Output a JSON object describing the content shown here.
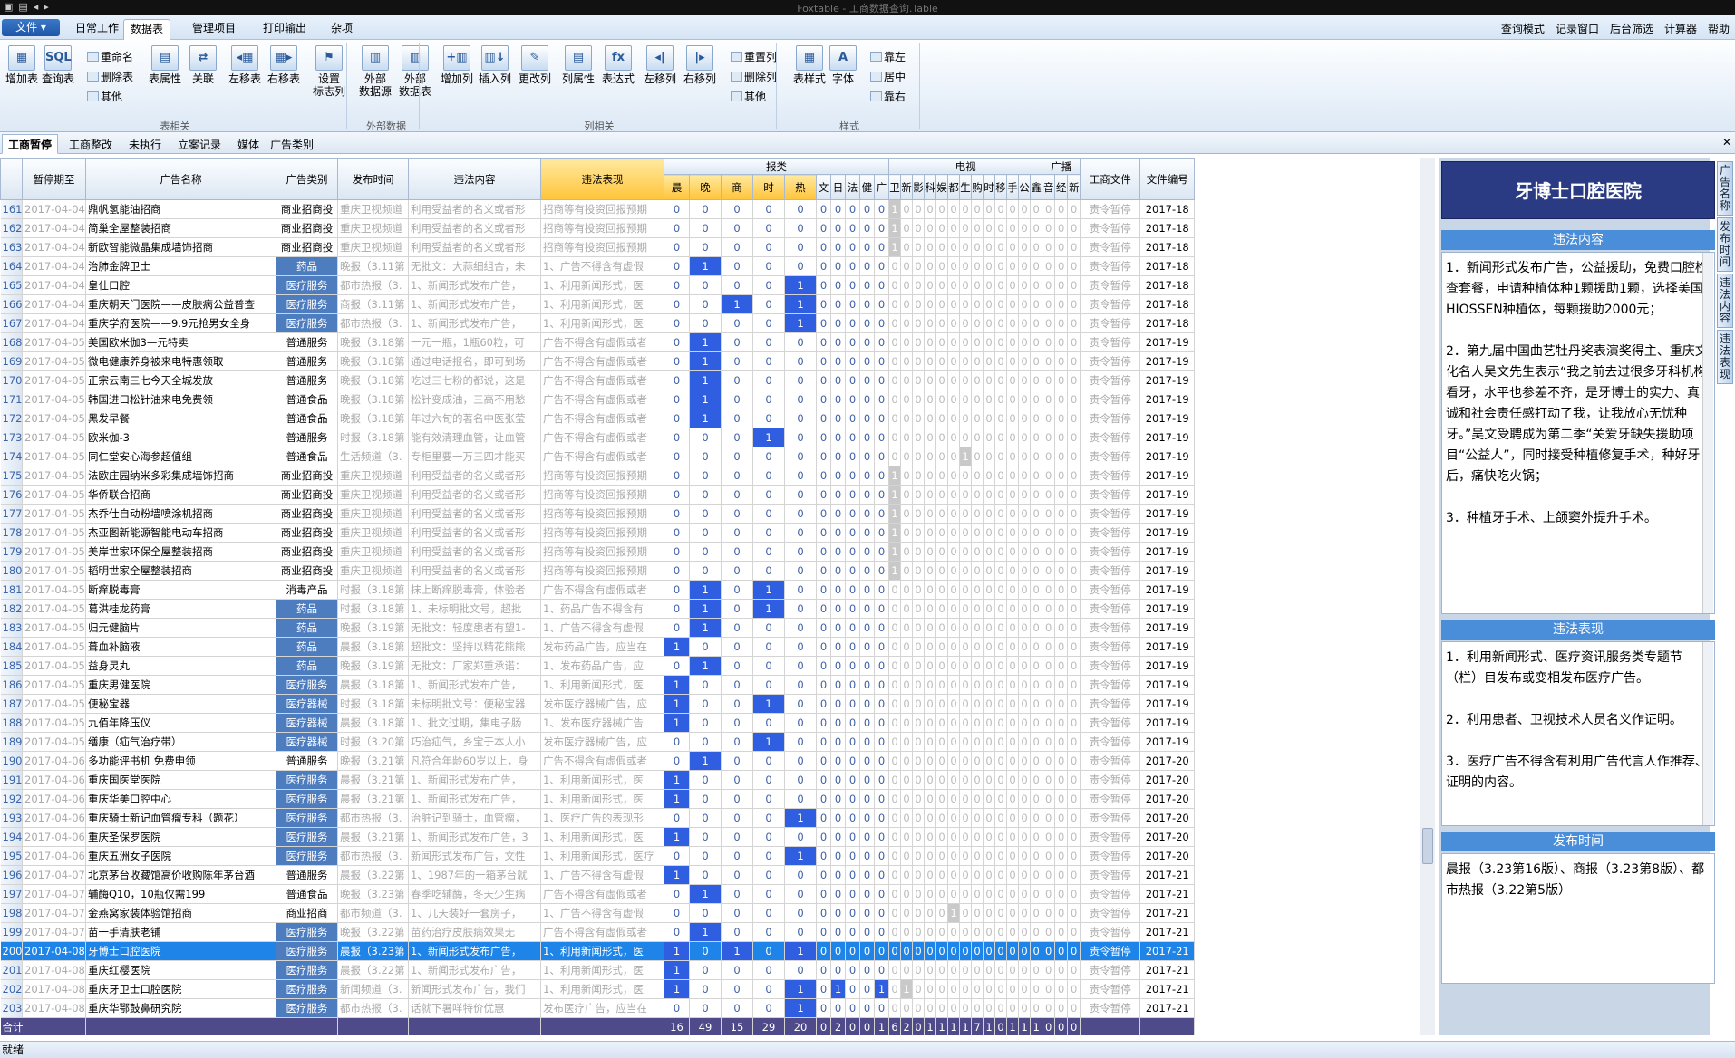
{
  "window_title": "Foxtable - 工商数据查询.Table",
  "menu": {
    "file": "文件 ▾",
    "tabs": [
      "日常工作",
      "数据表",
      "管理项目",
      "打印输出",
      "杂项"
    ],
    "active": 1,
    "right": [
      "查询模式",
      "记录窗口",
      "后台筛选",
      "计算器",
      "帮助"
    ]
  },
  "ribbon": {
    "big": [
      "增加表",
      "查询表",
      "表属性",
      "关联",
      "左移表",
      "右移表",
      "设置\n标志列",
      "外部\n数据源",
      "外部\n数据表",
      "增加列",
      "插入列",
      "更改列",
      "列属性",
      "表达式",
      "左移列",
      "右移列",
      "表样式",
      "字体"
    ],
    "small": [
      "重命名",
      "删除表",
      "其他",
      "重置列",
      "删除列",
      "其他",
      "靠左",
      "居中",
      "靠右"
    ],
    "groups": [
      "表相关",
      "外部数据",
      "列相关",
      "样式"
    ]
  },
  "sheet_tabs": [
    "工商暂停",
    "工商整改",
    "未执行",
    "立案记录",
    "媒体",
    "广告类别"
  ],
  "grid": {
    "headers": {
      "pause": "暂停期至",
      "name": "广告名称",
      "cat": "广告类别",
      "pub": "发布时间",
      "content": "违法内容",
      "behavior": "违法表现",
      "newspaper": "报类",
      "tv": "电视",
      "radio": "广播",
      "doc": "工商文件",
      "docno": "文件编号"
    },
    "newspaper_cols": [
      "晨",
      "晚",
      "商",
      "时",
      "热",
      "文",
      "日",
      "法",
      "健",
      "广"
    ],
    "tv_cols": [
      "卫",
      "新",
      "影",
      "科",
      "娱",
      "都",
      "生",
      "购",
      "时",
      "移",
      "手",
      "公",
      "鑫"
    ],
    "radio_cols": [
      "音",
      "经",
      "新"
    ],
    "rows": [
      [
        "161",
        "2017-04-04",
        "鼎帆氢能油招商",
        "商业招商投",
        "重庆卫视频道",
        "利用受益者的名义或者形",
        "招商等有投资回报预期",
        "0000000000",
        "1000000000000",
        "000",
        "责令暂停",
        "2017-18"
      ],
      [
        "162",
        "2017-04-04",
        "简巢全屋整装招商",
        "商业招商投",
        "重庆卫视频道",
        "利用受益者的名义或者形",
        "招商等有投资回报预期",
        "0000000000",
        "1000000000000",
        "000",
        "责令暂停",
        "2017-18"
      ],
      [
        "163",
        "2017-04-04",
        "新欧智能微晶集成墙饰招商",
        "商业招商投",
        "重庆卫视频道",
        "利用受益者的名义或者形",
        "招商等有投资回报预期",
        "0000000000",
        "1000000000000",
        "000",
        "责令暂停",
        "2017-18"
      ],
      [
        "164",
        "2017-04-04",
        "治肺金牌卫士",
        "药品",
        "晚报（3.11第",
        "无批文：大蒜细组合，未",
        "1、广告不得含有虚假",
        "0100000000",
        "0000000000000",
        "000",
        "责令暂停",
        "2017-18"
      ],
      [
        "165",
        "2017-04-04",
        "皇仕口腔",
        "医疗服务",
        "都市热报（3.",
        "1、新闻形式发布广告，",
        "1、利用新闻形式，医",
        "0000100000",
        "0000000000000",
        "000",
        "责令暂停",
        "2017-18"
      ],
      [
        "166",
        "2017-04-04",
        "重庆朝天门医院——皮肤病公益普查",
        "医疗服务",
        "商报（3.11第",
        "1、新闻形式发布广告，",
        "1、利用新闻形式，医",
        "0010100000",
        "0000000000000",
        "000",
        "责令暂停",
        "2017-18"
      ],
      [
        "167",
        "2017-04-04",
        "重庆学府医院——9.9元抢男女全身",
        "医疗服务",
        "都市热报（3.",
        "1、新闻形式发布广告，",
        "1、利用新闻形式，医",
        "0000100000",
        "0000000000000",
        "000",
        "责令暂停",
        "2017-18"
      ],
      [
        "168",
        "2017-04-05",
        "美国欧米伽3—元特卖",
        "普通服务",
        "晚报（3.18第",
        "一元一瓶，1瓶60粒，可",
        "广告不得含有虚假或者",
        "0100000000",
        "0000000000000",
        "000",
        "责令暂停",
        "2017-19"
      ],
      [
        "169",
        "2017-04-05",
        "微电健康养身被来电特惠领取",
        "普通服务",
        "晚报（3.18第",
        "通过电话报名，即可到场",
        "广告不得含有虚假或者",
        "0100000000",
        "0000000000000",
        "000",
        "责令暂停",
        "2017-19"
      ],
      [
        "170",
        "2017-04-05",
        "正宗云南三七今天全城发放",
        "普通服务",
        "晚报（3.18第",
        "吃过三七粉的都说，这是",
        "广告不得含有虚假或者",
        "0100000000",
        "0000000000000",
        "000",
        "责令暂停",
        "2017-19"
      ],
      [
        "171",
        "2017-04-05",
        "韩国进口松针油来电免费领",
        "普通食品",
        "晚报（3.18第",
        "松针变成油，三高不用愁",
        "广告不得含有虚假或者",
        "0100000000",
        "0000000000000",
        "000",
        "责令暂停",
        "2017-19"
      ],
      [
        "172",
        "2017-04-05",
        "黑发早餐",
        "普通食品",
        "晚报（3.18第",
        "年过六旬的著名中医张莹",
        "广告不得含有虚假或者",
        "0100000000",
        "0000000000000",
        "000",
        "责令暂停",
        "2017-19"
      ],
      [
        "173",
        "2017-04-05",
        "欧米伽-3",
        "普通服务",
        "时报（3.18第",
        "能有效清理血管，让血管",
        "广告不得含有虚假或者",
        "0001000000",
        "0000000000000",
        "000",
        "责令暂停",
        "2017-19"
      ],
      [
        "174",
        "2017-04-05",
        "同仁堂安心海参超值组",
        "普通食品",
        "生活频道（3.",
        "专柜里要一万三四才能买",
        "广告不得含有虚假或者",
        "0000000000",
        "0000001000000",
        "000",
        "责令暂停",
        "2017-19"
      ],
      [
        "175",
        "2017-04-05",
        "法欧庄园纳米多彩集成墙饰招商",
        "商业招商投",
        "重庆卫视频道",
        "利用受益者的名义或者形",
        "招商等有投资回报预期",
        "0000000000",
        "1000000000000",
        "000",
        "责令暂停",
        "2017-19"
      ],
      [
        "176",
        "2017-04-05",
        "华侨联合招商",
        "商业招商投",
        "重庆卫视频道",
        "利用受益者的名义或者形",
        "招商等有投资回报预期",
        "0000000000",
        "1000000000000",
        "000",
        "责令暂停",
        "2017-19"
      ],
      [
        "177",
        "2017-04-05",
        "杰乔仕自动粉墙喷涂机招商",
        "商业招商投",
        "重庆卫视频道",
        "利用受益者的名义或者形",
        "招商等有投资回报预期",
        "0000000000",
        "1000000000000",
        "000",
        "责令暂停",
        "2017-19"
      ],
      [
        "178",
        "2017-04-05",
        "杰亚图新能源智能电动车招商",
        "商业招商投",
        "重庆卫视频道",
        "利用受益者的名义或者形",
        "招商等有投资回报预期",
        "0000000000",
        "1000000000000",
        "000",
        "责令暂停",
        "2017-19"
      ],
      [
        "179",
        "2017-04-05",
        "美岸世家环保全屋整装招商",
        "商业招商投",
        "重庆卫视频道",
        "利用受益者的名义或者形",
        "招商等有投资回报预期",
        "0000000000",
        "1000000000000",
        "000",
        "责令暂停",
        "2017-19"
      ],
      [
        "180",
        "2017-04-05",
        "韬明世家全屋整装招商",
        "商业招商投",
        "重庆卫视频道",
        "利用受益者的名义或者形",
        "招商等有投资回报预期",
        "0000000000",
        "1000000000000",
        "000",
        "责令暂停",
        "2017-19"
      ],
      [
        "181",
        "2017-04-05",
        "断痒脱毒膏",
        "消毒产品",
        "时报（3.18第",
        "抹上断痒脱毒膏，体验者",
        "广告不得含有虚假或者",
        "0101000000",
        "0000000000000",
        "000",
        "责令暂停",
        "2017-19"
      ],
      [
        "182",
        "2017-04-05",
        "葛洪桂龙药膏",
        "药品",
        "时报（3.18第",
        "1、未标明批文号，超批",
        "1、药品广告不得含有",
        "0101000000",
        "0000000000000",
        "000",
        "责令暂停",
        "2017-19"
      ],
      [
        "183",
        "2017-04-05",
        "归元健脑片",
        "药品",
        "晚报（3.19第",
        "无批文：轻度患者有望1-",
        "1、广告不得含有虚假",
        "0100000000",
        "0000000000000",
        "000",
        "责令暂停",
        "2017-19"
      ],
      [
        "184",
        "2017-04-05",
        "葺血补脑液",
        "药品",
        "晨报（3.18第",
        "超批文：坚持以精花熊熊",
        "发布药品广告，应当在",
        "1000000000",
        "0000000000000",
        "000",
        "责令暂停",
        "2017-19"
      ],
      [
        "185",
        "2017-04-05",
        "益身灵丸",
        "药品",
        "晚报（3.19第",
        "无批文：厂家郑重承诺：",
        "1、发布药品广告，应",
        "0100000000",
        "0000000000000",
        "000",
        "责令暂停",
        "2017-19"
      ],
      [
        "186",
        "2017-04-05",
        "重庆男健医院",
        "医疗服务",
        "晨报（3.18第",
        "1、新闻形式发布广告，",
        "1、利用新闻形式，医",
        "1000000000",
        "0000000000000",
        "000",
        "责令暂停",
        "2017-19"
      ],
      [
        "187",
        "2017-04-05",
        "便秘宝器",
        "医疗器械",
        "时报（3.18第",
        "未标明批文号：便秘宝器",
        "发布医疗器械广告，应",
        "1001000000",
        "0000000000000",
        "000",
        "责令暂停",
        "2017-19"
      ],
      [
        "188",
        "2017-04-05",
        "九佰年降压仪",
        "医疗器械",
        "晨报（3.18第",
        "1、批文过期，集电子肠",
        "1、发布医疗器械广告",
        "1000000000",
        "0000000000000",
        "000",
        "责令暂停",
        "2017-19"
      ],
      [
        "189",
        "2017-04-05",
        "缮康（疝气治疗带）",
        "医疗器械",
        "时报（3.20第",
        "巧治疝气，乡宝于本人小",
        "发布医疗器械广告，应",
        "0001000000",
        "0000000000000",
        "000",
        "责令暂停",
        "2017-19"
      ],
      [
        "190",
        "2017-04-06",
        "多功能评书机 免费申领",
        "普通服务",
        "晚报（3.21第",
        "凡符合年龄60岁以上，身",
        "广告不得含有虚假或者",
        "0100000000",
        "0000000000000",
        "000",
        "责令暂停",
        "2017-20"
      ],
      [
        "191",
        "2017-04-06",
        "重庆国医堂医院",
        "医疗服务",
        "晨报（3.21第",
        "1、新闻形式发布广告，",
        "1、利用新闻形式，医",
        "1000000000",
        "0000000000000",
        "000",
        "责令暂停",
        "2017-20"
      ],
      [
        "192",
        "2017-04-06",
        "重庆华美口腔中心",
        "医疗服务",
        "晨报（3.21第",
        "1、新闻形式发布广告，",
        "1、利用新闻形式，医",
        "1000000000",
        "0000000000000",
        "000",
        "责令暂停",
        "2017-20"
      ],
      [
        "193",
        "2017-04-06",
        "重庆骑士新记血管瘤专科（题花）",
        "医疗服务",
        "都市热报（3.",
        "治脏记到骑士，血管瘤，",
        "1、医疗广告的表现形",
        "0000100000",
        "0000000000000",
        "000",
        "责令暂停",
        "2017-20"
      ],
      [
        "194",
        "2017-04-06",
        "重庆圣保罗医院",
        "医疗服务",
        "晨报（3.21第",
        "1、新闻形式发布广告，3",
        "1、利用新闻形式，医",
        "1000000000",
        "0000000000000",
        "000",
        "责令暂停",
        "2017-20"
      ],
      [
        "195",
        "2017-04-06",
        "重庆五洲女子医院",
        "医疗服务",
        "都市热报（3.",
        "新闻形式发布广告，文性",
        "1、利用新闻形式，医疗",
        "0000100000",
        "0000000000000",
        "000",
        "责令暂停",
        "2017-20"
      ],
      [
        "196",
        "2017-04-07",
        "北京茅台收藏馆高价收购陈年茅台酒",
        "普通服务",
        "晨报（3.22第",
        "1、1987年的一箱茅台就",
        "1、广告不得含有虚假",
        "1000000000",
        "0000000000000",
        "000",
        "责令暂停",
        "2017-21"
      ],
      [
        "197",
        "2017-04-07",
        "辅酶Q10，10瓶仅需199",
        "普通食品",
        "晚报（3.23第",
        "春季吃辅酶，冬天少生病",
        "广告不得含有虚假或者",
        "0100000000",
        "0000000000000",
        "000",
        "责令暂停",
        "2017-21"
      ],
      [
        "198",
        "2017-04-07",
        "金燕窝家装体验馆招商",
        "商业招商",
        "都市频道（3.",
        "1、几天装好一套房子，",
        "1、广告不得含有虚假",
        "0000000000",
        "0000010000000",
        "000",
        "责令暂停",
        "2017-21"
      ],
      [
        "199",
        "2017-04-07",
        "苗一手清肤老铺",
        "医疗服务",
        "晚报（3.22第",
        "苗药治疗皮肤病效果无",
        "广告不得含有虚假或者",
        "0100000000",
        "0000000000000",
        "000",
        "责令暂停",
        "2017-21"
      ],
      [
        "200",
        "2017-04-08",
        "牙博士口腔医院",
        "医疗服务",
        "晨报（3.23第",
        "1、新闻形式发布广告，",
        "1、利用新闻形式，医",
        "1010100000",
        "0000000000000",
        "000",
        "责令暂停",
        "2017-21"
      ],
      [
        "201",
        "2017-04-08",
        "重庆红樱医院",
        "医疗服务",
        "晨报（3.22第",
        "1、新闻形式发布广告，",
        "1、利用新闻形式，医",
        "1000000000",
        "0000000000000",
        "000",
        "责令暂停",
        "2017-21"
      ],
      [
        "202",
        "2017-04-08",
        "重庆牙卫士口腔医院",
        "医疗服务",
        "新闻频道（3.",
        "新闻形式发布广告，我们",
        "1、利用新闻形式，医",
        "1000101001",
        "0100000000000",
        "000",
        "责令暂停",
        "2017-21"
      ],
      [
        "203",
        "2017-04-08",
        "重庆华鄂鼓鼻研究院",
        "医疗服务",
        "都市热报（3.",
        "话就下暑咩特价优惠",
        "发布医疗广告，应当在",
        "0000100000",
        "0000000000000",
        "000",
        "责令暂停",
        "2017-21"
      ]
    ],
    "selected_row": "200",
    "total_label": "合计",
    "totals": [
      "16",
      "49",
      "15",
      "29",
      "20",
      "0",
      "2",
      "0",
      "0",
      "1",
      "6",
      "2",
      "0",
      "1",
      "1",
      "1",
      "1",
      "7",
      "1",
      "0",
      "1",
      "1",
      "1",
      "0",
      "0",
      "0"
    ]
  },
  "panel": {
    "title": "牙博士口腔医院",
    "content_header": "违法内容",
    "content": "1．新闻形式发布广告，公益援助，免费口腔检查套餐，申请种植体种1颗援助1颗，选择美国HIOSSEN种植体，每颗援助2000元；\n\n2．第九届中国曲艺牡丹奖表演奖得主、重庆文化名人吴文先生表示“我之前去过很多牙科机构看牙，水平也参差不齐，是牙博士的实力、真诚和社会责任感打动了我，让我放心无忧种牙。”吴文受聘成为第二季“关爱牙缺失援助项目“公益人”，同时接受种植修复手术，种好牙后，痛快吃火锅；\n\n3．种植牙手术、上颌窦外提升手术。",
    "behavior_header": "违法表现",
    "behavior": "1．利用新闻形式、医疗资讯服务类专题节（栏）目发布或变相发布医疗广告。\n\n2．利用患者、卫视技术人员名义作证明。\n\n3．医疗广告不得含有利用广告代言人作推荐、证明的内容。",
    "time_header": "发布时间",
    "time": "晨报（3.23第16版）、商报（3.23第8版）、都市热报（3.22第5版）"
  },
  "side_tabs": [
    "广告名称",
    "发布时间",
    "违法内容",
    "违法表现"
  ],
  "status": "就绪"
}
